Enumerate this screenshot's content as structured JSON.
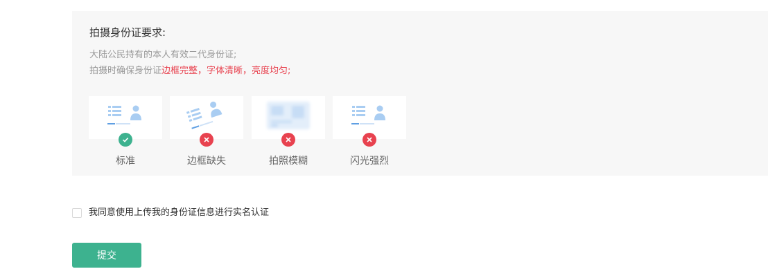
{
  "requirements": {
    "title": "拍摄身份证要求:",
    "line1": "大陆公民持有的本人有效二代身份证;",
    "line2_prefix": "拍摄时确保身份证",
    "line2_highlight": "边框完整，字体清晰，亮度均匀;"
  },
  "examples": [
    {
      "label": "标准",
      "status": "ok",
      "icon": "check-icon"
    },
    {
      "label": "边框缺失",
      "status": "bad",
      "icon": "cross-icon"
    },
    {
      "label": "拍照模糊",
      "status": "bad",
      "icon": "cross-icon"
    },
    {
      "label": "闪光强烈",
      "status": "bad",
      "icon": "cross-icon"
    }
  ],
  "agreement": {
    "checked": false,
    "text": "我同意使用上传我的身份证信息进行实名认证"
  },
  "submit_label": "提交",
  "colors": {
    "accent": "#3db28f",
    "error": "#e8424f",
    "panel_bg": "#f7f7f7",
    "illustration": "#a9cdf2"
  }
}
